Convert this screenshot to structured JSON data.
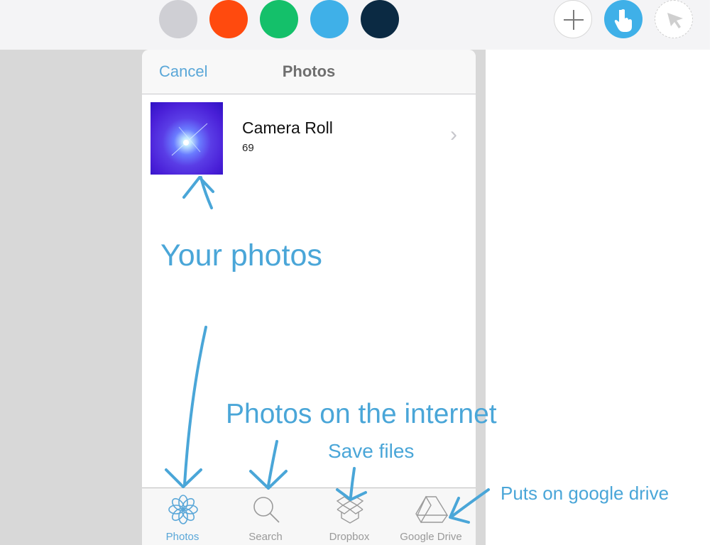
{
  "toolbar": {
    "colors": [
      "#cfcfd4",
      "#ff4a0e",
      "#14c06a",
      "#3fb0e8",
      "#0b2a43"
    ],
    "tools": [
      "add-icon",
      "hand-pointer-icon",
      "arrow-cursor-icon"
    ],
    "accent": "#3fb0e8"
  },
  "nav": {
    "cancel_label": "Cancel",
    "title": "Photos"
  },
  "album": {
    "name": "Camera Roll",
    "count": "69"
  },
  "tabs": [
    {
      "label": "Photos",
      "icon": "flower-icon",
      "active": true
    },
    {
      "label": "Search",
      "icon": "magnifier-icon",
      "active": false
    },
    {
      "label": "Dropbox",
      "icon": "dropbox-icon",
      "active": false
    },
    {
      "label": "Google Drive",
      "icon": "google-drive-icon",
      "active": false
    }
  ],
  "annotations": {
    "your_photos": "Your photos",
    "photos_internet": "Photos on the internet",
    "save_files": "Save files",
    "google_drive": "Puts on google drive"
  },
  "annotation_color": "#4aa6d8"
}
